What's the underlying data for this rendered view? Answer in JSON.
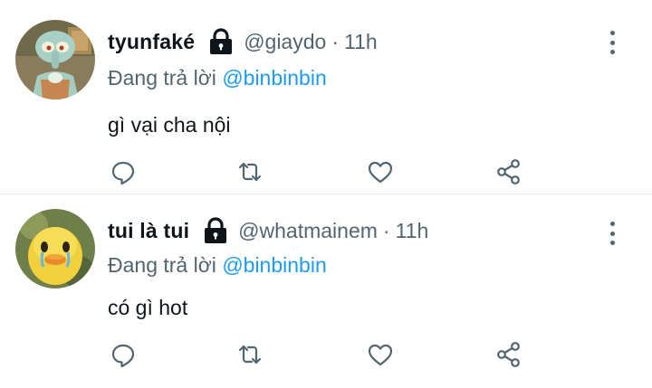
{
  "colors": {
    "text": "#0f1419",
    "secondary": "#536471",
    "accent": "#1d9bf0",
    "divider": "#e6e9ec"
  },
  "tweets": [
    {
      "display_name": "tyunfaké",
      "protected_icon": "lock-icon",
      "handle": "@giaydo",
      "separator": "·",
      "time": "11h",
      "replying_prefix": "Đang trả lời",
      "replying_to": "@binbinbin",
      "text": "gì vại cha nội",
      "actions": [
        "reply-icon",
        "retweet-icon",
        "like-icon",
        "share-icon"
      ]
    },
    {
      "display_name": "tui là tui",
      "protected_icon": "lock-icon",
      "handle": "@whatmainem",
      "separator": "·",
      "time": "11h",
      "replying_prefix": "Đang trả lời",
      "replying_to": "@binbinbin",
      "text": "có gì hot",
      "actions": [
        "reply-icon",
        "retweet-icon",
        "like-icon",
        "share-icon"
      ]
    }
  ]
}
